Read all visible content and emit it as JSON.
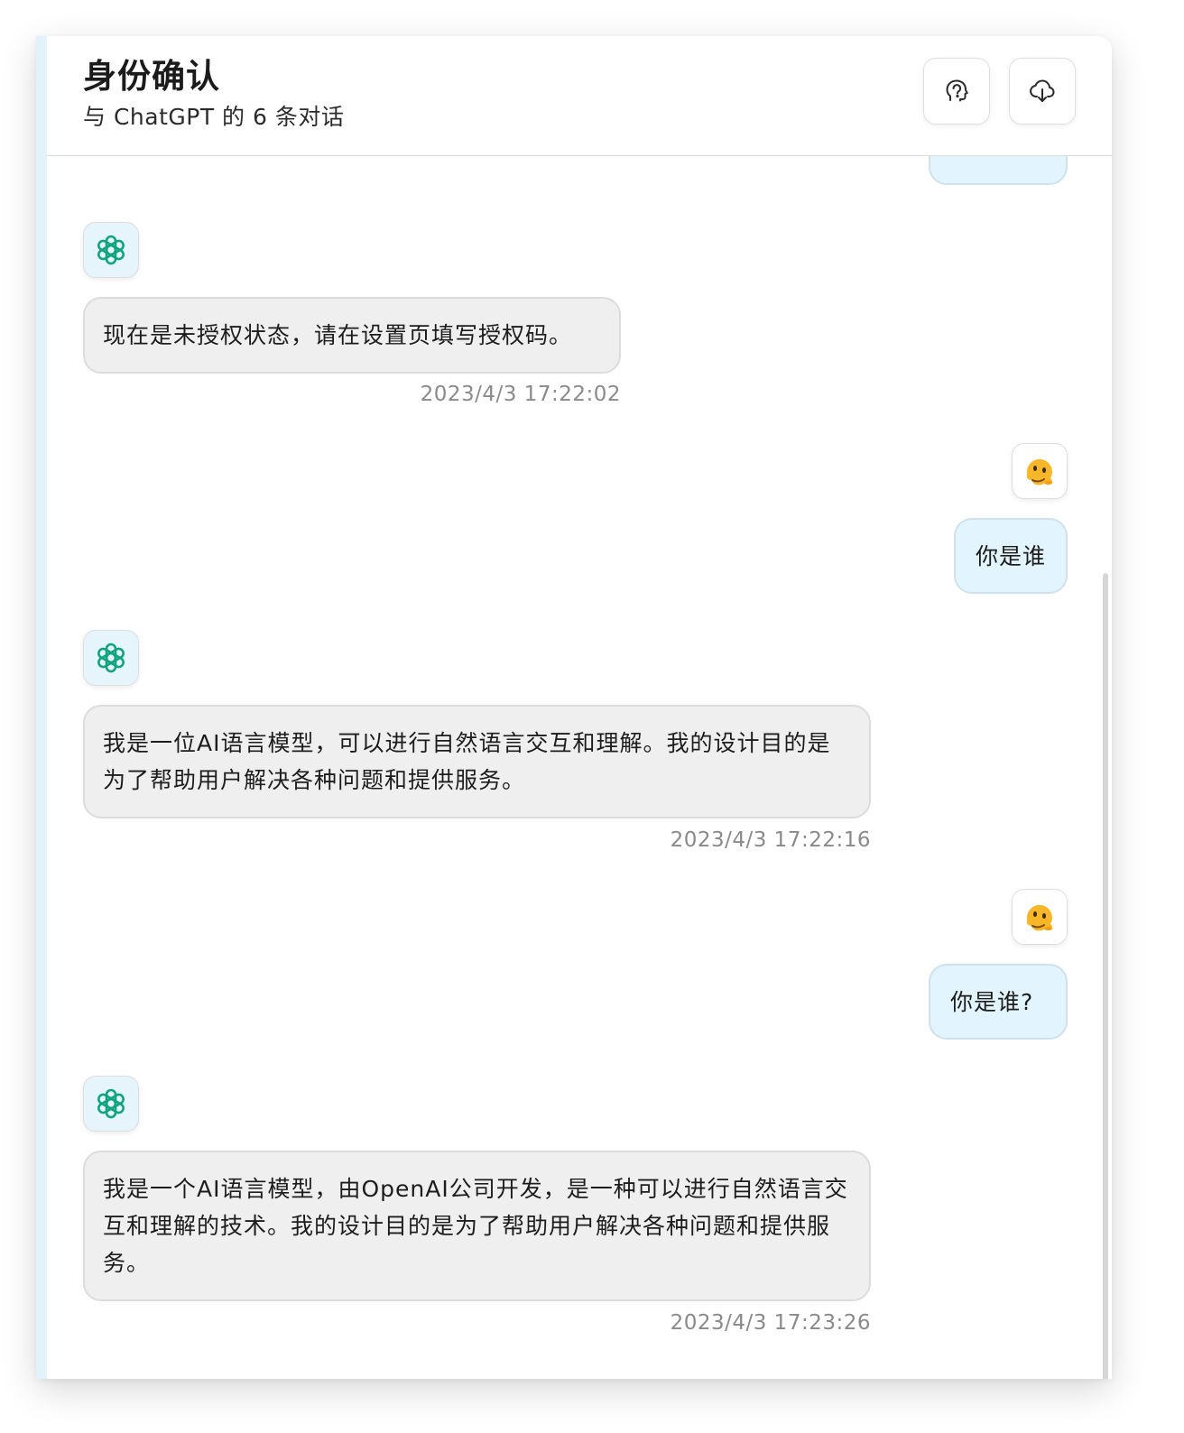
{
  "header": {
    "title": "身份确认",
    "subtitle": "与 ChatGPT 的 6 条对话"
  },
  "messages": [
    {
      "role": "bot",
      "text": "现在是未授权状态，请在设置页填写授权码。",
      "time": "2023/4/3 17:22:02"
    },
    {
      "role": "user",
      "text": "你是谁"
    },
    {
      "role": "bot",
      "text": "我是一位AI语言模型，可以进行自然语言交互和理解。我的设计目的是为了帮助用户解决各种问题和提供服务。",
      "time": "2023/4/3 17:22:16"
    },
    {
      "role": "user",
      "text": "你是谁?"
    },
    {
      "role": "bot",
      "text": "我是一个AI语言模型，由OpenAI公司开发，是一种可以进行自然语言交互和理解的技术。我的设计目的是为了帮助用户解决各种问题和提供服务。",
      "time": "2023/4/3 17:23:26"
    }
  ],
  "icons": {
    "header_left": "brain-icon",
    "header_right": "cloud-download-icon",
    "bot_avatar": "openai-logo-icon",
    "user_avatar": "melting-face-emoji"
  },
  "colors": {
    "bot_bubble": "#efefef",
    "user_bubble": "#e2f4fd",
    "bot_avatar_bg": "#e6f5fb",
    "openai_green": "#10a37f",
    "timestamp": "#8a8a8a"
  }
}
